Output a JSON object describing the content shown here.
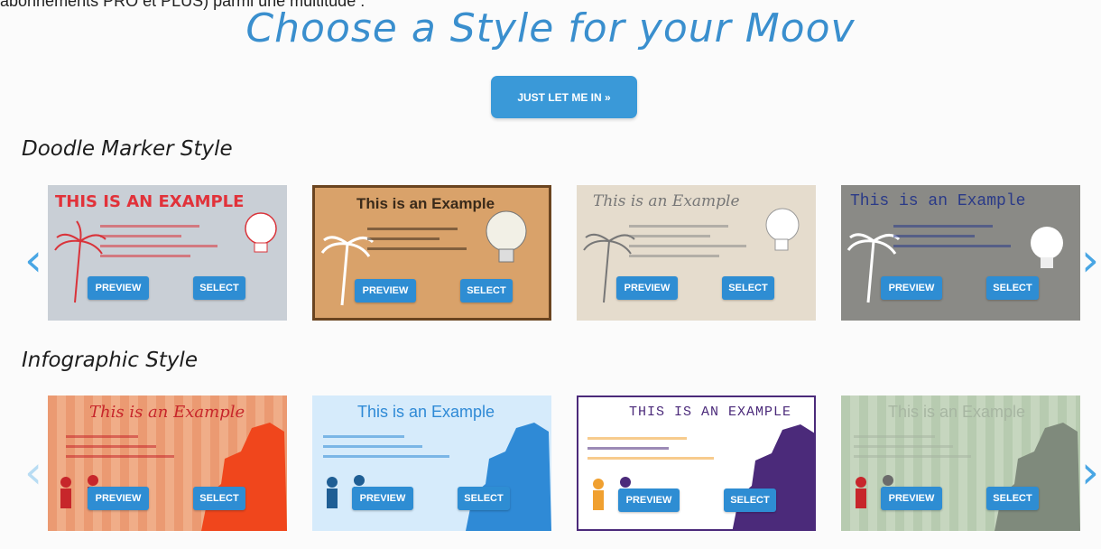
{
  "top_text": "abonnements PRO et PLUS) parmi une multitude :",
  "title": "Choose a Style for your Moov",
  "enter_button": "JUST LET ME IN »",
  "sections": [
    {
      "title": "Doodle Marker Style",
      "cards": [
        {
          "example_text": "THIS IS AN EXAMPLE",
          "preview": "PREVIEW",
          "select": "SELECT"
        },
        {
          "example_text": "This is an Example",
          "preview": "PREVIEW",
          "select": "SELECT"
        },
        {
          "example_text": "This is an Example",
          "preview": "PREVIEW",
          "select": "SELECT"
        },
        {
          "example_text": "This is an Example",
          "preview": "PREVIEW",
          "select": "SELECT"
        }
      ]
    },
    {
      "title": "Infographic Style",
      "cards": [
        {
          "example_text": "This is an Example",
          "preview": "PREVIEW",
          "select": "SELECT"
        },
        {
          "example_text": "This is an Example",
          "preview": "PREVIEW",
          "select": "SELECT"
        },
        {
          "example_text": "THIS IS AN EXAMPLE",
          "preview": "PREVIEW",
          "select": "SELECT"
        },
        {
          "example_text": "This is an Example",
          "preview": "PREVIEW",
          "select": "SELECT"
        }
      ]
    }
  ],
  "icons": {
    "prev": "chevron-left-icon",
    "next": "chevron-right-icon"
  },
  "colors": {
    "accent": "#3a99d8",
    "title": "#3a8fce",
    "button": "#2e8dd3"
  }
}
